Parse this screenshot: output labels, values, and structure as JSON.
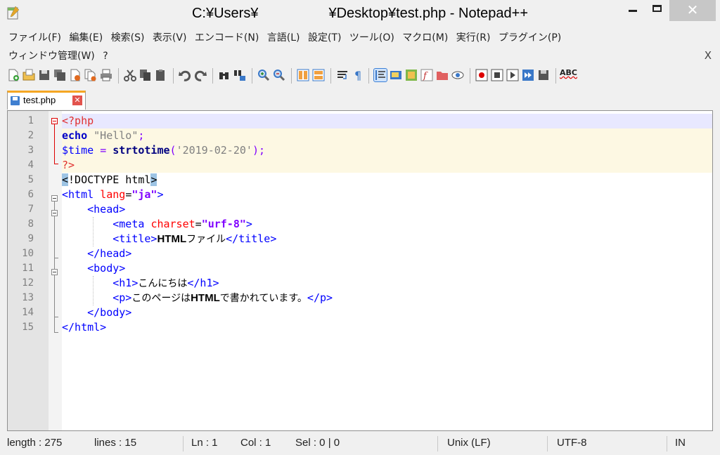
{
  "window": {
    "title_prefix": "C:¥Users¥",
    "title_suffix": "¥Desktop¥test.php - Notepad++",
    "close_glyph": "✕"
  },
  "menu": {
    "row1": [
      "ファイル(F)",
      "編集(E)",
      "検索(S)",
      "表示(V)",
      "エンコード(N)",
      "言語(L)",
      "設定(T)",
      "ツール(O)",
      "マクロ(M)",
      "実行(R)",
      "プラグイン(P)"
    ],
    "row2": [
      "ウィンドウ管理(W)",
      "?"
    ],
    "close_label": "X"
  },
  "toolbar": {
    "icons": [
      "new-file-icon",
      "open-file-icon",
      "save-icon",
      "save-all-icon",
      "close-icon",
      "close-all-icon",
      "print-icon",
      "cut-icon",
      "copy-icon",
      "paste-icon",
      "undo-icon",
      "redo-icon",
      "find-icon",
      "replace-icon",
      "zoom-in-icon",
      "zoom-out-icon",
      "sync-vertical-icon",
      "sync-horizontal-icon",
      "word-wrap-icon",
      "show-all-chars-icon",
      "indent-guide-icon",
      "user-language-icon",
      "document-map-icon",
      "function-list-icon",
      "folder-workspace-icon",
      "monitoring-icon",
      "record-macro-icon",
      "stop-record-icon",
      "play-macro-icon",
      "run-macro-multiple-icon",
      "save-macro-icon",
      "spell-check-icon"
    ],
    "spell_label": "ABC"
  },
  "tab": {
    "label": "test.php",
    "close_glyph": "✕"
  },
  "editor": {
    "line_numbers": [
      "1",
      "2",
      "3",
      "4",
      "5",
      "6",
      "7",
      "8",
      "9",
      "10",
      "11",
      "12",
      "13",
      "14",
      "15"
    ],
    "lines": {
      "l1": {
        "a": "<?php"
      },
      "l2": {
        "a": "echo",
        "b": " ",
        "c": "\"Hello\"",
        "d": ";"
      },
      "l3": {
        "a": "$time",
        "b": " ",
        "c": "=",
        "d": " ",
        "e": "strtotime",
        "f": "(",
        "g": "'2019-02-20'",
        "h": ");"
      },
      "l4": {
        "a": "?>"
      },
      "l5": {
        "a": "<",
        "b": "!DOCTYPE html",
        "c": ">"
      },
      "l6": {
        "a": "<html",
        "b": " ",
        "c": "lang",
        "d": "=",
        "e": "\"ja\"",
        "f": ">"
      },
      "l7": {
        "a": "    ",
        "b": "<head>"
      },
      "l8": {
        "a": "        ",
        "b": "<meta",
        "c": " ",
        "d": "charset",
        "e": "=",
        "f": "\"urf-8\"",
        "g": ">"
      },
      "l9": {
        "a": "        ",
        "b": "<title>",
        "c": "HTML",
        "d": "ファイル",
        "e": "</title>"
      },
      "l10": {
        "a": "    ",
        "b": "</head>"
      },
      "l11": {
        "a": "    ",
        "b": "<body>"
      },
      "l12": {
        "a": "        ",
        "b": "<h1>",
        "c": "こんにちは",
        "d": "</h1>"
      },
      "l13": {
        "a": "        ",
        "b": "<p>",
        "c": "このページは",
        "d": "HTML",
        "e": "で書かれています。",
        "f": "</p>"
      },
      "l14": {
        "a": "    ",
        "b": "</body>"
      },
      "l15": {
        "a": "</html>"
      }
    }
  },
  "status": {
    "length": "length : 275",
    "lines": "lines : 15",
    "ln": "Ln : 1",
    "col": "Col : 1",
    "sel": "Sel : 0 | 0",
    "eol": "Unix (LF)",
    "encoding": "UTF-8",
    "mode": "IN"
  },
  "colors": {
    "current_line": "#e8e8ff",
    "php_block": "#fdf8e3",
    "tab_accent": "#f5a623",
    "php_delim": "#e0302f",
    "keyword": "#0000c8",
    "html_tag": "#0000ff",
    "html_attr": "#ff0000",
    "attr_value": "#8000ff"
  }
}
